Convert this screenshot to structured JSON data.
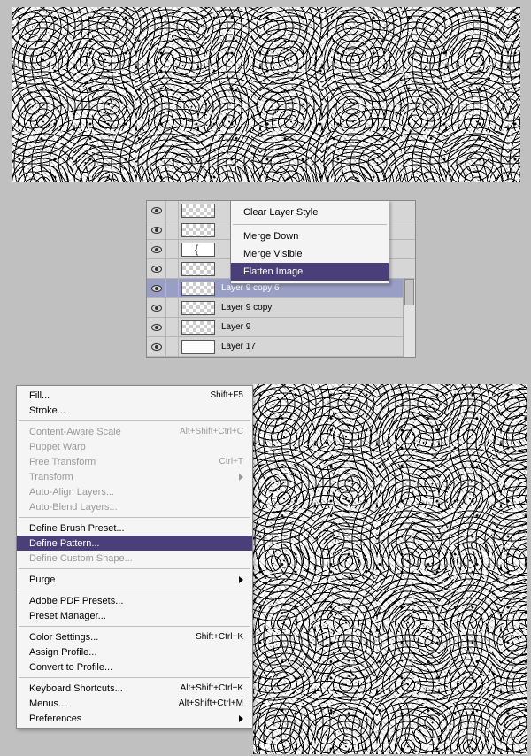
{
  "layer_context_menu": {
    "items": [
      {
        "label": "Clear Layer Style",
        "highlighted": false
      },
      {
        "label": "Merge Down",
        "highlighted": false
      },
      {
        "label": "Merge Visible",
        "highlighted": false
      },
      {
        "label": "Flatten Image",
        "highlighted": true
      }
    ]
  },
  "layers_panel": {
    "rows": [
      {
        "name": "",
        "thumb": "checker",
        "selected": false,
        "visible": true
      },
      {
        "name": "",
        "thumb": "checker",
        "selected": false,
        "visible": true
      },
      {
        "name": "",
        "thumb": "brace",
        "selected": false,
        "visible": true
      },
      {
        "name": "",
        "thumb": "checker",
        "selected": false,
        "visible": true
      },
      {
        "name": "Layer 9 copy 6",
        "thumb": "checker",
        "selected": true,
        "visible": true
      },
      {
        "name": "Layer 9 copy",
        "thumb": "checker",
        "selected": false,
        "visible": true
      },
      {
        "name": "Layer 9",
        "thumb": "checker",
        "selected": false,
        "visible": true
      },
      {
        "name": "Layer 17",
        "thumb": "white",
        "selected": false,
        "visible": true
      }
    ]
  },
  "edit_menu": {
    "groups": [
      [
        {
          "label": "Fill...",
          "shortcut": "Shift+F5",
          "enabled": true
        },
        {
          "label": "Stroke...",
          "shortcut": "",
          "enabled": true
        }
      ],
      [
        {
          "label": "Content-Aware Scale",
          "shortcut": "Alt+Shift+Ctrl+C",
          "enabled": false
        },
        {
          "label": "Puppet Warp",
          "shortcut": "",
          "enabled": false
        },
        {
          "label": "Free Transform",
          "shortcut": "Ctrl+T",
          "enabled": false
        },
        {
          "label": "Transform",
          "shortcut": "",
          "enabled": false,
          "submenu": true
        },
        {
          "label": "Auto-Align Layers...",
          "shortcut": "",
          "enabled": false
        },
        {
          "label": "Auto-Blend Layers...",
          "shortcut": "",
          "enabled": false
        }
      ],
      [
        {
          "label": "Define Brush Preset...",
          "shortcut": "",
          "enabled": true
        },
        {
          "label": "Define Pattern...",
          "shortcut": "",
          "enabled": true,
          "highlighted": true
        },
        {
          "label": "Define Custom Shape...",
          "shortcut": "",
          "enabled": false
        }
      ],
      [
        {
          "label": "Purge",
          "shortcut": "",
          "enabled": true,
          "submenu": true
        }
      ],
      [
        {
          "label": "Adobe PDF Presets...",
          "shortcut": "",
          "enabled": true
        },
        {
          "label": "Preset Manager...",
          "shortcut": "",
          "enabled": true
        }
      ],
      [
        {
          "label": "Color Settings...",
          "shortcut": "Shift+Ctrl+K",
          "enabled": true
        },
        {
          "label": "Assign Profile...",
          "shortcut": "",
          "enabled": true
        },
        {
          "label": "Convert to Profile...",
          "shortcut": "",
          "enabled": true
        }
      ],
      [
        {
          "label": "Keyboard Shortcuts...",
          "shortcut": "Alt+Shift+Ctrl+K",
          "enabled": true
        },
        {
          "label": "Menus...",
          "shortcut": "Alt+Shift+Ctrl+M",
          "enabled": true
        },
        {
          "label": "Preferences",
          "shortcut": "",
          "enabled": true,
          "submenu": true
        }
      ]
    ]
  }
}
